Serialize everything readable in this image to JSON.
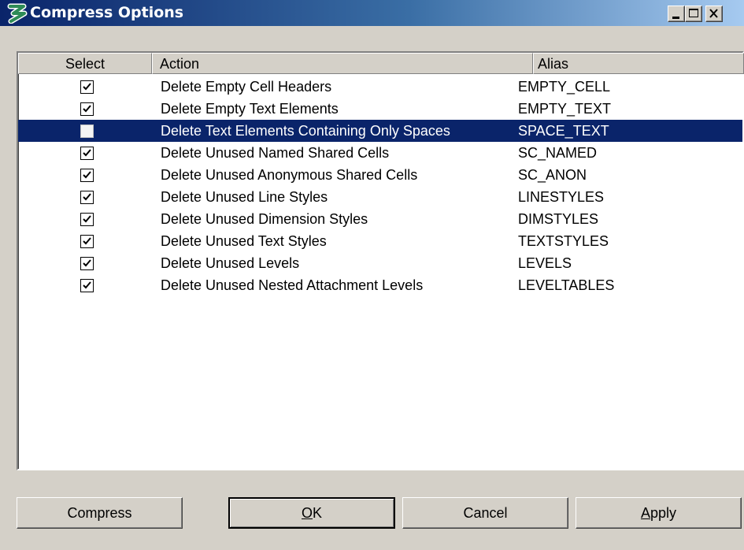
{
  "window": {
    "title": "Compress Options",
    "controls": [
      "minimize-icon",
      "maximize-icon",
      "close-icon"
    ]
  },
  "table": {
    "columns": [
      "Select",
      "Action",
      "Alias"
    ],
    "rows": [
      {
        "checked": true,
        "action": "Delete Empty Cell Headers",
        "alias": "EMPTY_CELL"
      },
      {
        "checked": true,
        "action": "Delete Empty Text Elements",
        "alias": "EMPTY_TEXT"
      },
      {
        "checked": false,
        "action": "Delete Text Elements Containing Only Spaces",
        "alias": "SPACE_TEXT",
        "selected": true
      },
      {
        "checked": true,
        "action": "Delete Unused Named Shared Cells",
        "alias": "SC_NAMED"
      },
      {
        "checked": true,
        "action": "Delete Unused Anonymous Shared Cells",
        "alias": "SC_ANON"
      },
      {
        "checked": true,
        "action": "Delete Unused Line Styles",
        "alias": "LINESTYLES"
      },
      {
        "checked": true,
        "action": "Delete Unused Dimension Styles",
        "alias": "DIMSTYLES"
      },
      {
        "checked": true,
        "action": "Delete Unused Text Styles",
        "alias": "TEXTSTYLES"
      },
      {
        "checked": true,
        "action": "Delete Unused Levels",
        "alias": "LEVELS"
      },
      {
        "checked": true,
        "action": "Delete Unused Nested Attachment Levels",
        "alias": "LEVELTABLES"
      }
    ]
  },
  "buttons": {
    "compress": "Compress",
    "ok": {
      "mnemonic": "O",
      "rest": "K"
    },
    "cancel": "Cancel",
    "apply": {
      "mnemonic": "A",
      "rest": "pply"
    }
  },
  "colors": {
    "selection": "#0a246a",
    "titlebar_start": "#0a246a",
    "titlebar_end": "#a6caf0",
    "face": "#d4d0c8"
  }
}
